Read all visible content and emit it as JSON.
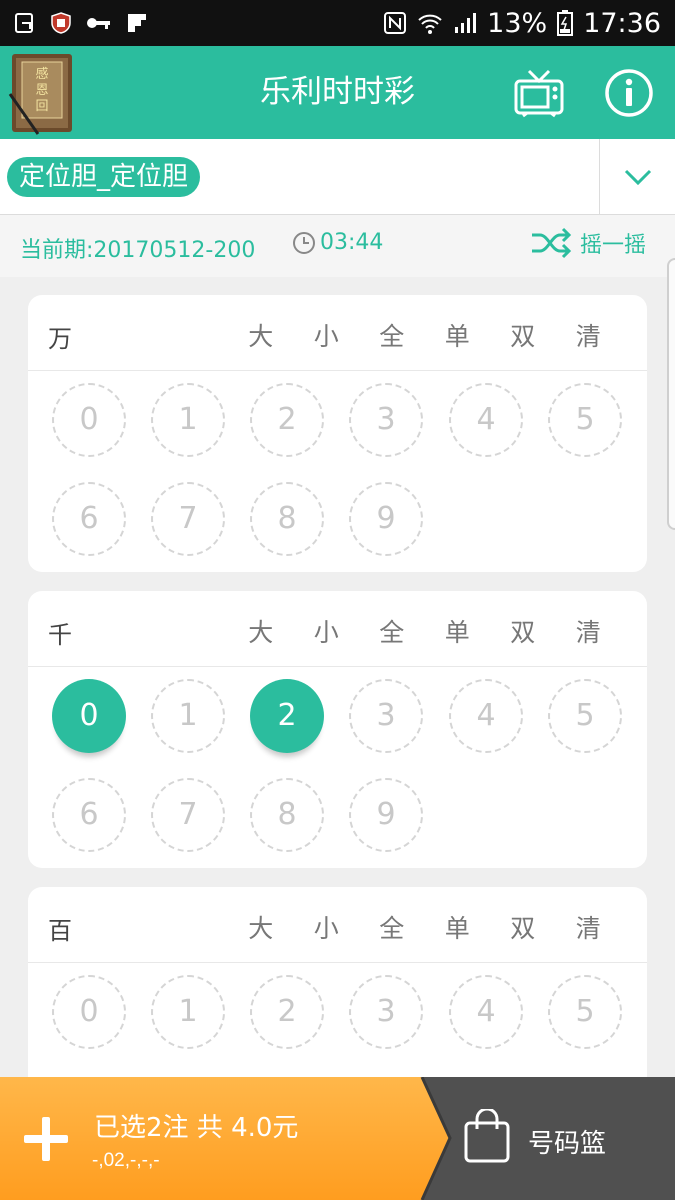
{
  "statusbar": {
    "battery": "13%",
    "time": "17:36"
  },
  "header": {
    "title": "乐利时时彩"
  },
  "selector": {
    "play_type": "定位胆_定位胆"
  },
  "period": {
    "label": "当前期:20170512-200",
    "countdown": "03:44",
    "shake_label": "摇一摇"
  },
  "quick_options": [
    "大",
    "小",
    "全",
    "单",
    "双",
    "清"
  ],
  "cards": [
    {
      "label": "万",
      "numbers": [
        "0",
        "1",
        "2",
        "3",
        "4",
        "5",
        "6",
        "7",
        "8",
        "9"
      ],
      "selected": []
    },
    {
      "label": "千",
      "numbers": [
        "0",
        "1",
        "2",
        "3",
        "4",
        "5",
        "6",
        "7",
        "8",
        "9"
      ],
      "selected": [
        "0",
        "2"
      ]
    },
    {
      "label": "百",
      "numbers": [
        "0",
        "1",
        "2",
        "3",
        "4",
        "5"
      ],
      "selected": []
    }
  ],
  "bottom": {
    "summary": "已选2注 共 4.0元",
    "numbers_text": "-,02,-,-,-",
    "basket_label": "号码篮"
  },
  "colors": {
    "accent": "#2bbd9e",
    "orange": "#ffa726",
    "dark": "#555555"
  }
}
